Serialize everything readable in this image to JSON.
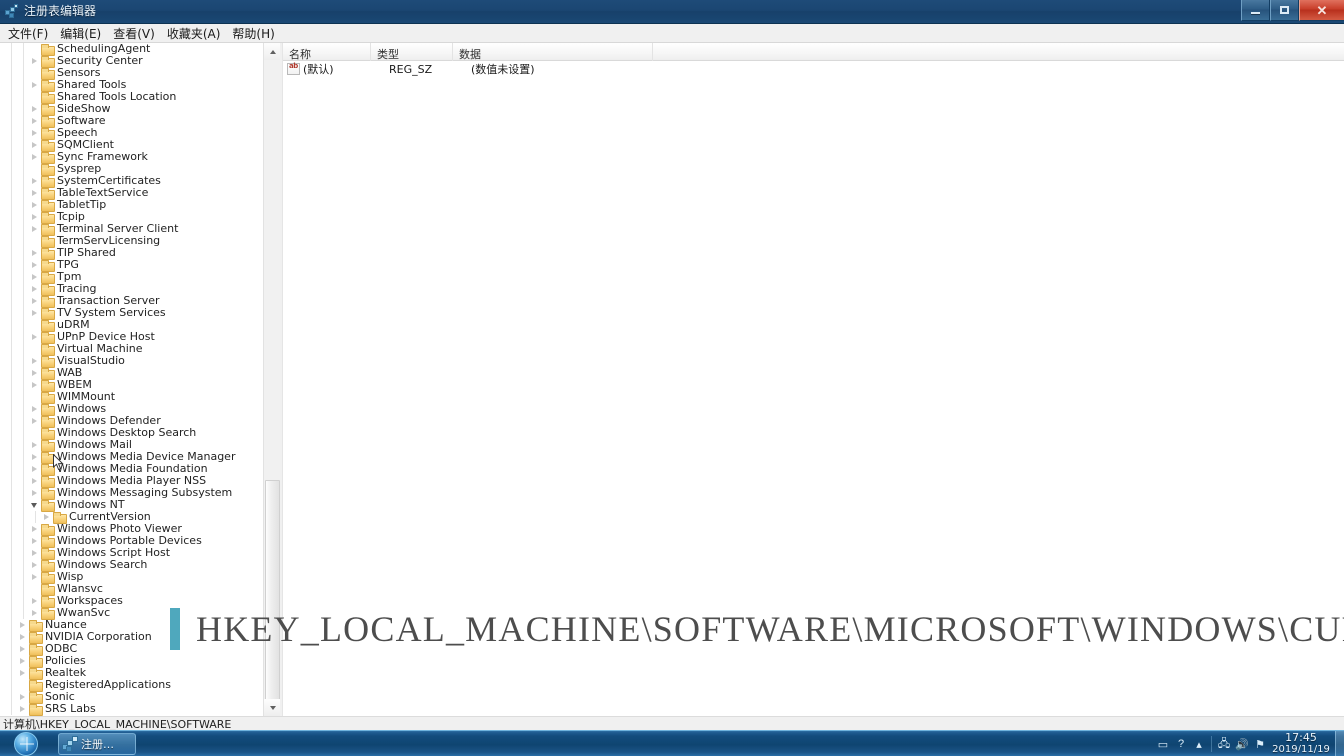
{
  "window": {
    "title": "注册表编辑器",
    "icon": "registry-editor-icon",
    "buttons": {
      "minimize": "最小化",
      "maximize": "最大化",
      "close": "关闭"
    }
  },
  "menubar": {
    "items": [
      {
        "label": "文件(F)",
        "name": "menu-file"
      },
      {
        "label": "编辑(E)",
        "name": "menu-edit"
      },
      {
        "label": "查看(V)",
        "name": "menu-view"
      },
      {
        "label": "收藏夹(A)",
        "name": "menu-favorites"
      },
      {
        "label": "帮助(H)",
        "name": "menu-help"
      }
    ]
  },
  "tree": {
    "items": [
      {
        "label": "SchedulingAgent",
        "depth": 3,
        "expandable": false
      },
      {
        "label": "Security Center",
        "depth": 3,
        "expandable": true
      },
      {
        "label": "Sensors",
        "depth": 3,
        "expandable": false
      },
      {
        "label": "Shared Tools",
        "depth": 3,
        "expandable": true
      },
      {
        "label": "Shared Tools Location",
        "depth": 3,
        "expandable": false
      },
      {
        "label": "SideShow",
        "depth": 3,
        "expandable": true
      },
      {
        "label": "Software",
        "depth": 3,
        "expandable": true
      },
      {
        "label": "Speech",
        "depth": 3,
        "expandable": true
      },
      {
        "label": "SQMClient",
        "depth": 3,
        "expandable": true
      },
      {
        "label": "Sync Framework",
        "depth": 3,
        "expandable": true
      },
      {
        "label": "Sysprep",
        "depth": 3,
        "expandable": false
      },
      {
        "label": "SystemCertificates",
        "depth": 3,
        "expandable": true
      },
      {
        "label": "TableTextService",
        "depth": 3,
        "expandable": true
      },
      {
        "label": "TabletTip",
        "depth": 3,
        "expandable": true
      },
      {
        "label": "Tcpip",
        "depth": 3,
        "expandable": true
      },
      {
        "label": "Terminal Server Client",
        "depth": 3,
        "expandable": true
      },
      {
        "label": "TermServLicensing",
        "depth": 3,
        "expandable": false
      },
      {
        "label": "TIP Shared",
        "depth": 3,
        "expandable": true
      },
      {
        "label": "TPG",
        "depth": 3,
        "expandable": true
      },
      {
        "label": "Tpm",
        "depth": 3,
        "expandable": true
      },
      {
        "label": "Tracing",
        "depth": 3,
        "expandable": true
      },
      {
        "label": "Transaction Server",
        "depth": 3,
        "expandable": true
      },
      {
        "label": "TV System Services",
        "depth": 3,
        "expandable": true
      },
      {
        "label": "uDRM",
        "depth": 3,
        "expandable": false
      },
      {
        "label": "UPnP Device Host",
        "depth": 3,
        "expandable": true
      },
      {
        "label": "Virtual Machine",
        "depth": 3,
        "expandable": false
      },
      {
        "label": "VisualStudio",
        "depth": 3,
        "expandable": true
      },
      {
        "label": "WAB",
        "depth": 3,
        "expandable": true
      },
      {
        "label": "WBEM",
        "depth": 3,
        "expandable": true
      },
      {
        "label": "WIMMount",
        "depth": 3,
        "expandable": false
      },
      {
        "label": "Windows",
        "depth": 3,
        "expandable": true
      },
      {
        "label": "Windows Defender",
        "depth": 3,
        "expandable": true
      },
      {
        "label": "Windows Desktop Search",
        "depth": 3,
        "expandable": false
      },
      {
        "label": "Windows Mail",
        "depth": 3,
        "expandable": true
      },
      {
        "label": "Windows Media Device Manager",
        "depth": 3,
        "expandable": true
      },
      {
        "label": "Windows Media Foundation",
        "depth": 3,
        "expandable": true
      },
      {
        "label": "Windows Media Player NSS",
        "depth": 3,
        "expandable": true
      },
      {
        "label": "Windows Messaging Subsystem",
        "depth": 3,
        "expandable": true
      },
      {
        "label": "Windows NT",
        "depth": 3,
        "expandable": true,
        "expanded": true
      },
      {
        "label": "CurrentVersion",
        "depth": 4,
        "expandable": true
      },
      {
        "label": "Windows Photo Viewer",
        "depth": 3,
        "expandable": true
      },
      {
        "label": "Windows Portable Devices",
        "depth": 3,
        "expandable": true
      },
      {
        "label": "Windows Script Host",
        "depth": 3,
        "expandable": true
      },
      {
        "label": "Windows Search",
        "depth": 3,
        "expandable": true
      },
      {
        "label": "Wisp",
        "depth": 3,
        "expandable": true
      },
      {
        "label": "Wlansvc",
        "depth": 3,
        "expandable": false
      },
      {
        "label": "Workspaces",
        "depth": 3,
        "expandable": true
      },
      {
        "label": "WwanSvc",
        "depth": 3,
        "expandable": true
      },
      {
        "label": "Nuance",
        "depth": 2,
        "expandable": true
      },
      {
        "label": "NVIDIA Corporation",
        "depth": 2,
        "expandable": true
      },
      {
        "label": "ODBC",
        "depth": 2,
        "expandable": true
      },
      {
        "label": "Policies",
        "depth": 2,
        "expandable": true
      },
      {
        "label": "Realtek",
        "depth": 2,
        "expandable": true
      },
      {
        "label": "RegisteredApplications",
        "depth": 2,
        "expandable": false
      },
      {
        "label": "Sonic",
        "depth": 2,
        "expandable": true
      },
      {
        "label": "SRS Labs",
        "depth": 2,
        "expandable": true
      }
    ]
  },
  "list": {
    "columns": [
      {
        "label": "名称",
        "name": "column-name"
      },
      {
        "label": "类型",
        "name": "column-type"
      },
      {
        "label": "数据",
        "name": "column-data"
      }
    ],
    "rows": [
      {
        "name": "(默认)",
        "type": "REG_SZ",
        "data": "(数值未设置)"
      }
    ]
  },
  "overlay": {
    "path": "HKEY_LOCAL_MACHINE\\SOFTWARE\\MICROSOFT\\WINDOWS\\CURRENTVERSION\\EXPLORER",
    "accent_color": "#4fa8bd",
    "text_color": "#4d4d4d"
  },
  "statusbar": {
    "path": "计算机\\HKEY_LOCAL_MACHINE\\SOFTWARE"
  },
  "taskbar": {
    "start": "start-orb",
    "tasks": [
      {
        "label": "注册…",
        "name": "taskbar-button-regedit"
      }
    ],
    "tray": {
      "icons": [
        "keyboard-icon",
        "help-icon",
        "show-hidden-icon",
        "network-icon",
        "volume-icon",
        "action-center-icon"
      ],
      "time": "17:45",
      "date": "2019/11/19"
    }
  }
}
